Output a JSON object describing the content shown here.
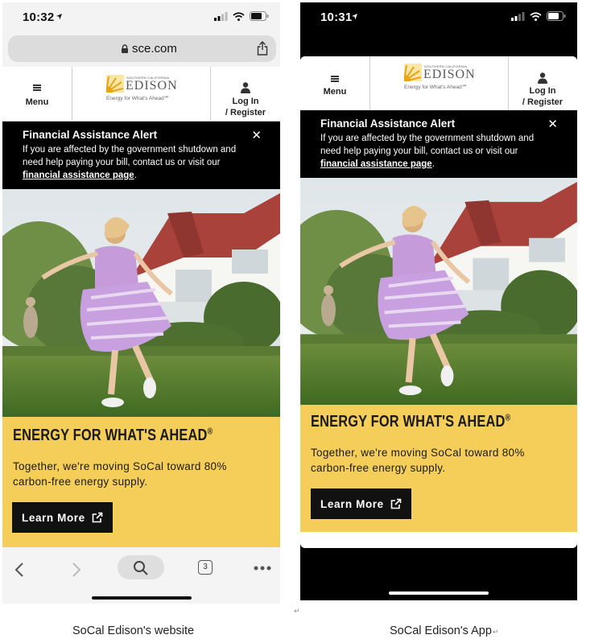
{
  "website": {
    "status_time": "10:32",
    "url": "sce.com",
    "tab_count": "3"
  },
  "app": {
    "status_time": "10:31"
  },
  "header": {
    "menu_label": "Menu",
    "logo_small_text": "SOUTHERN CALIFORNIA",
    "logo_name": "EDISON",
    "logo_tagline": "Energy for What's Ahead℠",
    "login_line1": "Log In",
    "login_line2": "/ Register"
  },
  "alert": {
    "title": "Financial Assistance Alert",
    "close": "✕",
    "body": "If you are affected by the government shutdown and need help paying your bill, contact us or visit our",
    "link": "financial assistance page",
    "end": "."
  },
  "promo": {
    "title": "ENERGY FOR WHAT'S AHEAD",
    "title_mark": "®",
    "body": "Together, we're moving SoCal toward 80% carbon-free energy supply.",
    "button": "Learn More"
  },
  "captions": {
    "website": "SoCal Edison's website",
    "app": "SoCal Edison's App",
    "para_mark": "↵"
  },
  "colors": {
    "promo_yellow": "#f5cd59",
    "alert_black": "#000000",
    "logo_sun": "#e8a317"
  }
}
